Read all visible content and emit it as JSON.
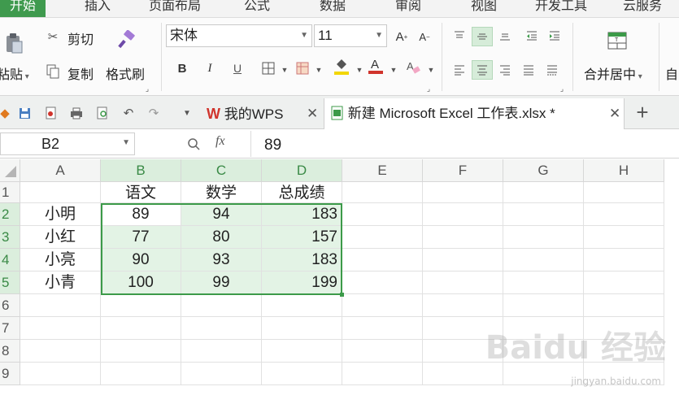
{
  "menu": {
    "tabs": [
      "开始",
      "插入",
      "页面布局",
      "公式",
      "数据",
      "审阅",
      "视图",
      "开发工具",
      "云服务"
    ],
    "active": "开始"
  },
  "ribbon": {
    "paste_label": "粘贴",
    "cut_label": "剪切",
    "copy_label": "复制",
    "format_painter_label": "格式刷",
    "font_name": "宋体",
    "font_size": "11",
    "bold": "B",
    "italic": "I",
    "merge_center_label": "合并居中",
    "auto_wrap_label": "自",
    "font_color": "#d0342c",
    "fill_color": "#f2d600"
  },
  "tabs": {
    "my_wps": "我的WPS",
    "workbook": "新建 Microsoft Excel 工作表.xlsx *"
  },
  "formula_bar": {
    "name_box": "B2",
    "fx_label": "fx",
    "value": "89"
  },
  "sheet": {
    "columns": [
      "A",
      "B",
      "C",
      "D",
      "E",
      "F",
      "G",
      "H"
    ],
    "rows": [
      "1",
      "2",
      "3",
      "4",
      "5",
      "6",
      "7",
      "8",
      "9"
    ],
    "header_row": [
      "",
      "语文",
      "数学",
      "总成绩"
    ],
    "data": [
      [
        "小明",
        "89",
        "94",
        "183"
      ],
      [
        "小红",
        "77",
        "80",
        "157"
      ],
      [
        "小亮",
        "90",
        "93",
        "183"
      ],
      [
        "小青",
        "100",
        "99",
        "199"
      ]
    ]
  },
  "watermark": {
    "text": "Baidu 经验",
    "url": "jingyan.baidu.com"
  },
  "colors": {
    "accent": "#3f9a4e",
    "selection_fill": "#e3f3e5",
    "selection_border": "#3c9a49"
  }
}
